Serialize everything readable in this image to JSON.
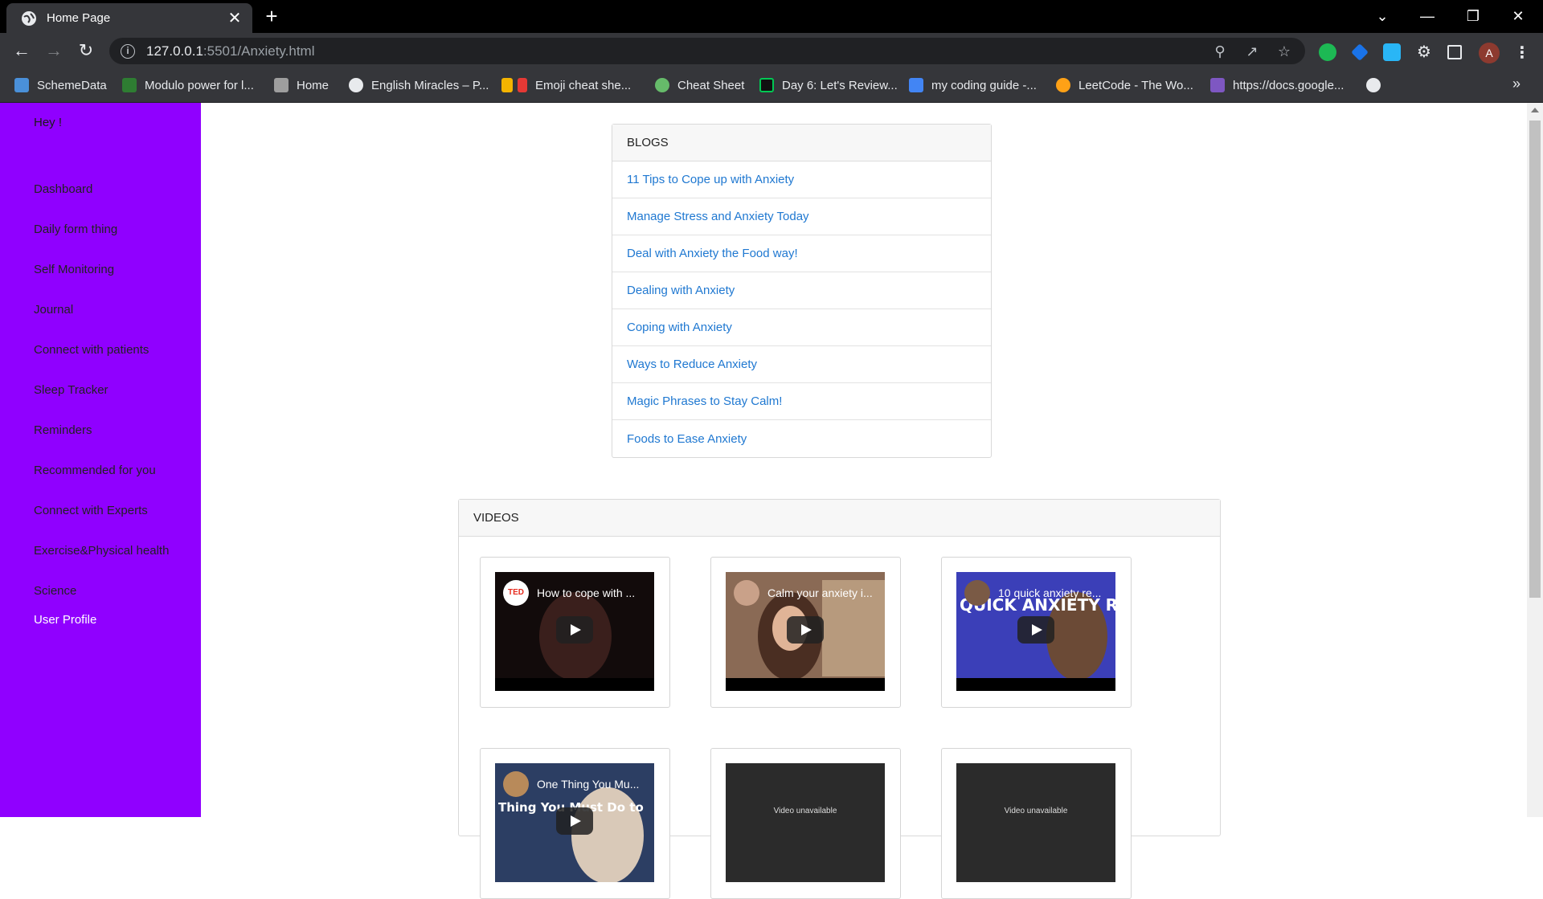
{
  "browser": {
    "tab_title": "Home Page",
    "tab_close": "✕",
    "new_tab": "+",
    "window_controls": {
      "tab_search": "⌄",
      "minimize": "—",
      "restore": "❐",
      "close": "✕"
    },
    "url_host": "127.0.0.1",
    "url_rest": ":5501/Anxiety.html",
    "profile_initial": "A",
    "bookmarks": [
      {
        "label": "SchemeData",
        "color": "#4a90d9"
      },
      {
        "label": "Modulo power for l...",
        "color": "#2e7d32"
      },
      {
        "label": "Home",
        "color": "#9e9e9e"
      },
      {
        "label": "English Miracles – P...",
        "color": "#e8eaed"
      },
      {
        "label": "Emoji cheat she...",
        "color": "#f4b400"
      },
      {
        "label": "Cheat Sheet",
        "color": "#66bb6a"
      },
      {
        "label": "Day 6: Let's Review...",
        "color": "#00c853"
      },
      {
        "label": "my coding guide -...",
        "color": "#4285f4"
      },
      {
        "label": "LeetCode - The Wo...",
        "color": "#ffa116"
      },
      {
        "label": "https://docs.google...",
        "color": "#7e57c2"
      },
      {
        "label": "",
        "color": "#e8eaed"
      }
    ],
    "bookmarks_more": "»"
  },
  "sidebar": {
    "greeting": "Hey !",
    "items": [
      {
        "label": "Dashboard"
      },
      {
        "label": "Daily form thing"
      },
      {
        "label": "Self Monitoring"
      },
      {
        "label": "Journal"
      },
      {
        "label": "Connect with patients"
      },
      {
        "label": "Sleep Tracker"
      },
      {
        "label": "Reminders"
      },
      {
        "label": "Recommended for you"
      },
      {
        "label": "Connect with Experts"
      },
      {
        "label": "Exercise&Physical health"
      },
      {
        "label": "Science"
      },
      {
        "label": "User Profile"
      }
    ]
  },
  "blogs": {
    "header": "BLOGS",
    "links": [
      "11 Tips to Cope up with Anxiety",
      "Manage Stress and Anxiety Today",
      "Deal with Anxiety the Food way!",
      "Dealing with Anxiety",
      "Coping with Anxiety",
      "Ways to Reduce Anxiety",
      "Magic Phrases to Stay Calm!",
      "Foods to Ease Anxiety"
    ]
  },
  "videos": {
    "header": "VIDEOS",
    "items": [
      {
        "title": "How to cope with ...",
        "channel": "TED"
      },
      {
        "title": "Calm your anxiety i...",
        "channel": ""
      },
      {
        "title": "10 quick anxiety re...",
        "channel": "",
        "overlay_text": "QUICK ANXIETY RELIEF"
      },
      {
        "title": "One Thing You Mu...",
        "channel": "",
        "overlay_text": "Thing You Must Do to"
      },
      {
        "unavailable_text": "Video unavailable"
      },
      {
        "unavailable_text": "Video unavailable"
      }
    ]
  },
  "colors": {
    "sidebar": "#9000ff",
    "link": "#1f78d1",
    "chrome_dark": "#35363a"
  }
}
